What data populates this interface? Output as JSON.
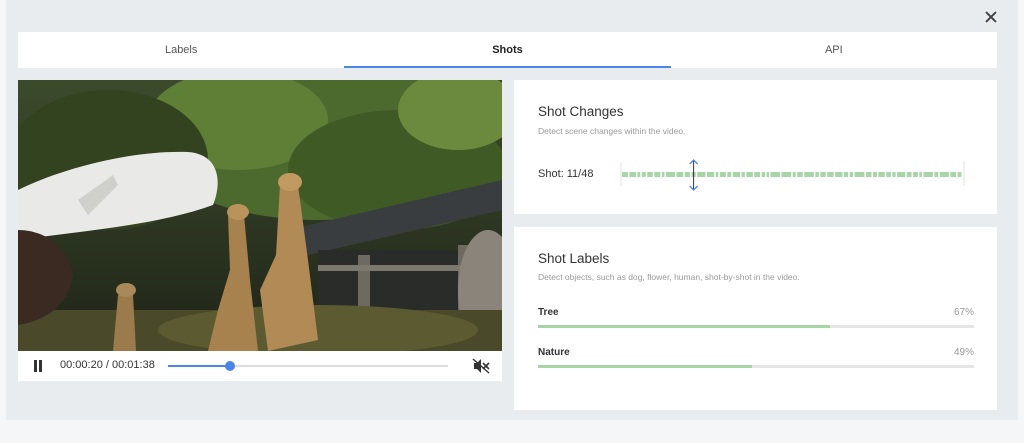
{
  "tabs": [
    {
      "label": "Labels",
      "active": false
    },
    {
      "label": "Shots",
      "active": true
    },
    {
      "label": "API",
      "active": false
    }
  ],
  "player": {
    "time": "00:00:20 / 00:01:38",
    "progress": 0.22,
    "muted": true
  },
  "shot_changes": {
    "title": "Shot Changes",
    "subtitle": "Detect scene changes within the video.",
    "shot_counter": "Shot: 11/48",
    "current_shot": 11,
    "total_shots": 48
  },
  "shot_labels": {
    "title": "Shot Labels",
    "subtitle": "Detect objects, such as dog, flower, human, shot-by-shot in the video.",
    "items": [
      {
        "name": "Tree",
        "percent_text": "67%",
        "value": 0.67
      },
      {
        "name": "Nature",
        "percent_text": "49%",
        "value": 0.49
      }
    ]
  },
  "colors": {
    "accent": "#4a86e8",
    "bar": "#a8d5a8",
    "timeline": "#a8d5a8"
  }
}
